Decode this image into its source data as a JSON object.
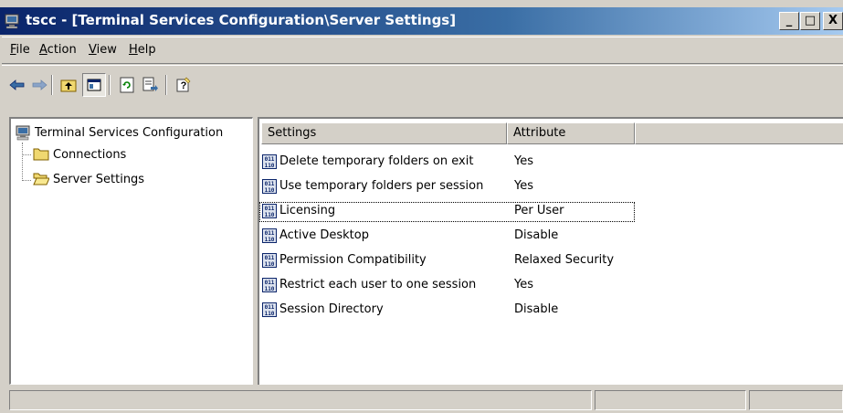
{
  "window": {
    "title": "tscc - [Terminal Services Configuration\\Server Settings]",
    "controls": {
      "minimize": "_",
      "maximize": "□",
      "close": "X"
    },
    "accent": "#0a246a"
  },
  "menu": [
    {
      "key": "F",
      "rest": "ile"
    },
    {
      "key": "A",
      "rest": "ction"
    },
    {
      "key": "V",
      "rest": "iew"
    },
    {
      "key": "H",
      "rest": "elp"
    }
  ],
  "toolbar": {
    "icons": [
      "back-arrow-icon",
      "forward-arrow-icon",
      "up-folder-icon",
      "show-hide-tree-icon",
      "refresh-icon",
      "export-list-icon",
      "help-icon"
    ]
  },
  "tree": {
    "root": "Terminal Services Configuration",
    "children": [
      "Connections",
      "Server Settings"
    ],
    "selected": "Server Settings"
  },
  "list": {
    "columns": [
      "Settings",
      "Attribute"
    ],
    "rows": [
      {
        "setting": "Delete temporary folders on exit",
        "attribute": "Yes"
      },
      {
        "setting": "Use temporary folders per session",
        "attribute": "Yes"
      },
      {
        "setting": "Licensing",
        "attribute": "Per User"
      },
      {
        "setting": "Active Desktop",
        "attribute": "Disable"
      },
      {
        "setting": "Permission Compatibility",
        "attribute": "Relaxed Security"
      },
      {
        "setting": "Restrict each user to one session",
        "attribute": "Yes"
      },
      {
        "setting": "Session Directory",
        "attribute": "Disable"
      }
    ],
    "focused_row": "Licensing"
  }
}
